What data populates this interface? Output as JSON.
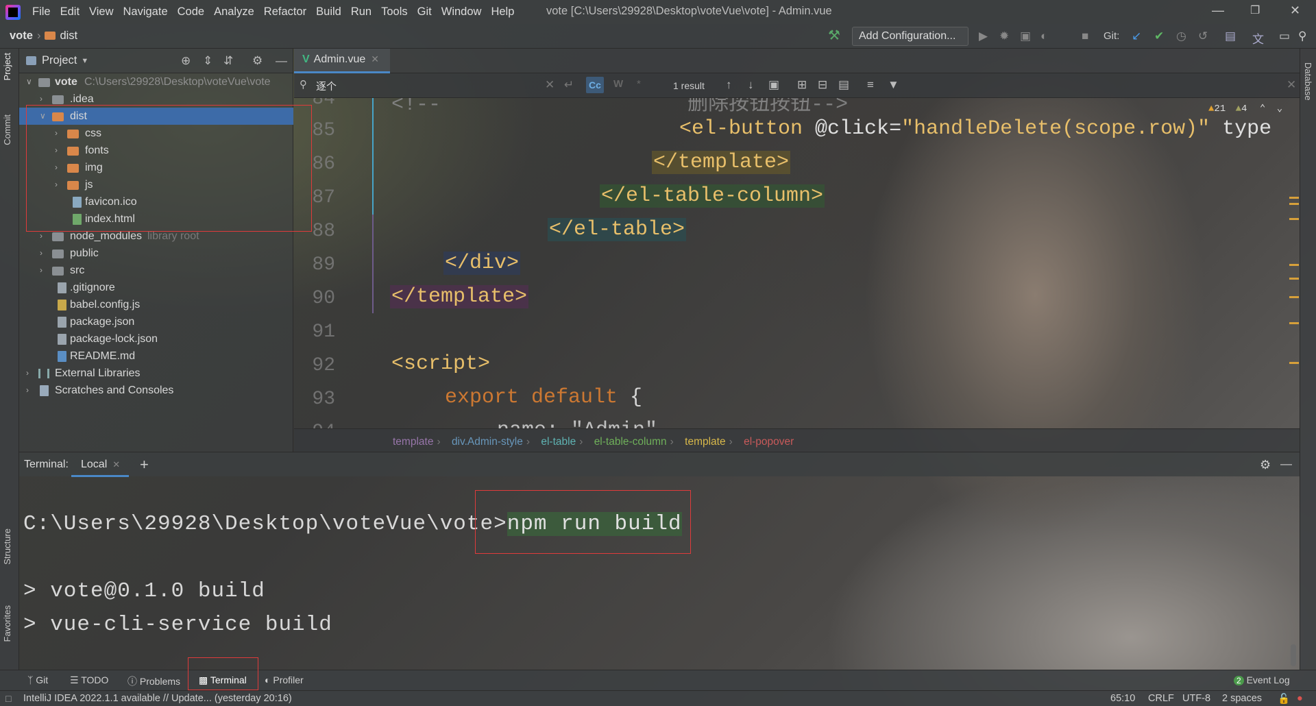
{
  "window": {
    "title": "vote [C:\\Users\\29928\\Desktop\\voteVue\\vote] - Admin.vue"
  },
  "menu": [
    "File",
    "Edit",
    "View",
    "Navigate",
    "Code",
    "Analyze",
    "Refactor",
    "Build",
    "Run",
    "Tools",
    "Git",
    "Window",
    "Help"
  ],
  "nav": {
    "project": "vote",
    "folder": "dist",
    "add_config": "Add Configuration...",
    "git_label": "Git:"
  },
  "left_stripe": {
    "project": "Project",
    "commit": "Commit",
    "structure": "Structure",
    "favorites": "Favorites"
  },
  "right_stripe": {
    "database": "Database"
  },
  "project_panel": {
    "title": "Project",
    "root": {
      "name": "vote",
      "path": "C:\\Users\\29928\\Desktop\\voteVue\\vote"
    },
    "items": [
      {
        "name": ".idea"
      },
      {
        "name": "dist"
      },
      {
        "name": "css"
      },
      {
        "name": "fonts"
      },
      {
        "name": "img"
      },
      {
        "name": "js"
      },
      {
        "name": "favicon.ico"
      },
      {
        "name": "index.html"
      },
      {
        "name": "node_modules",
        "hint": "library root"
      },
      {
        "name": "public"
      },
      {
        "name": "src"
      },
      {
        "name": ".gitignore"
      },
      {
        "name": "babel.config.js"
      },
      {
        "name": "package.json"
      },
      {
        "name": "package-lock.json"
      },
      {
        "name": "README.md"
      },
      {
        "name": "External Libraries"
      },
      {
        "name": "Scratches and Consoles"
      }
    ]
  },
  "editor": {
    "tab": "Admin.vue",
    "find": {
      "query": "逐个",
      "result": "1 result",
      "cc": "Cc",
      "w": "W",
      "star": "*"
    },
    "warnings": {
      "warn_count": "21",
      "weak_count": "4"
    },
    "lines": [
      {
        "no": "84",
        "text": "<!--                    删除按钮按钮-->"
      },
      {
        "no": "85",
        "pre": "",
        "tag_open": "<el-button ",
        "attr": "@click=",
        "str": "\"handleDelete(scope.row)\"",
        "rest": " type"
      },
      {
        "no": "86",
        "text": "</template>"
      },
      {
        "no": "87",
        "text": "</el-table-column>"
      },
      {
        "no": "88",
        "text": "</el-table>"
      },
      {
        "no": "89",
        "text": "</div>"
      },
      {
        "no": "90",
        "text": "</template>"
      },
      {
        "no": "91",
        "text": ""
      },
      {
        "no": "92",
        "text": "<script>"
      },
      {
        "no": "93",
        "kw": "export default",
        "rest": " {"
      },
      {
        "no": "94",
        "text": "name: \"Admin\","
      }
    ],
    "breadcrumbs": [
      "template",
      "div.Admin-style",
      "el-table",
      "el-table-column",
      "template",
      "el-popover"
    ]
  },
  "terminal": {
    "label": "Terminal:",
    "tab": "Local",
    "prompt": "C:\\Users\\29928\\Desktop\\voteVue\\vote>",
    "command": "npm run build",
    "out1": "> vote@0.1.0 build",
    "out2": "> vue-cli-service build"
  },
  "tool_windows": [
    "Git",
    "TODO",
    "Problems",
    "Terminal",
    "Profiler"
  ],
  "event_log": {
    "count": "2",
    "label": "Event Log"
  },
  "status": {
    "message": "IntelliJ IDEA 2022.1.1 available // Update... (yesterday 20:16)",
    "position": "65:10",
    "line_sep": "CRLF",
    "encoding": "UTF-8",
    "indent": "2 spaces"
  },
  "colors": {
    "accent": "#4a88c7",
    "selection": "#3d6ba8",
    "highlight_box": "#e03b3b",
    "tag": "#e8bf6a",
    "string": "#6a8759",
    "keyword": "#cc7832"
  }
}
